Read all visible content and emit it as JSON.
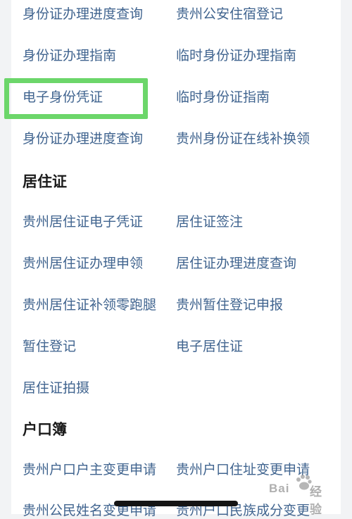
{
  "sections": [
    {
      "title": null,
      "rows": [
        [
          "身份证办理进度查询",
          "贵州公安住宿登记"
        ],
        [
          "身份证办理指南",
          "临时身份证办理指南"
        ],
        [
          "电子身份凭证",
          "临时身份证指南"
        ],
        [
          "身份证办理进度查询",
          "贵州身份证在线补换领"
        ]
      ]
    },
    {
      "title": "居住证",
      "rows": [
        [
          "贵州居住证电子凭证",
          "居住证签注"
        ],
        [
          "贵州居住证办理申领",
          "居住证办理进度查询"
        ],
        [
          "贵州居住证补领零跑腿",
          "贵州暂住登记申报"
        ],
        [
          "暂住登记",
          "电子居住证"
        ],
        [
          "居住证拍摄",
          ""
        ]
      ]
    },
    {
      "title": "户口簿",
      "rows": [
        [
          "贵州户口户主变更申请",
          "贵州户口住址变更申请"
        ],
        [
          "贵州公民姓名变更申请",
          "贵州户口民族成分变更"
        ]
      ]
    }
  ],
  "highlight": {
    "color": "#6cd66a",
    "target": "电子身份凭证"
  },
  "watermark": {
    "text": "Bai",
    "suffix": "经验"
  },
  "colors": {
    "link": "#40648f",
    "heading": "#1b1b1b",
    "background": "#f2f3f5",
    "card": "#ffffff"
  }
}
